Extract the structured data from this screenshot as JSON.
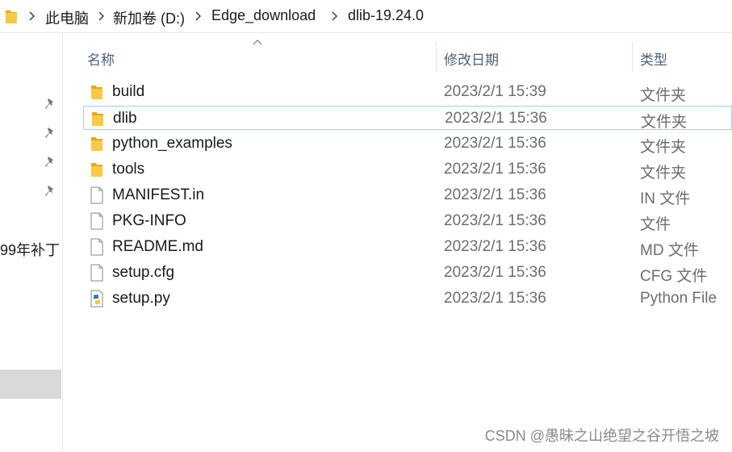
{
  "breadcrumb": [
    "此电脑",
    "新加卷 (D:)",
    "Edge_download",
    "dlib-19.24.0"
  ],
  "nav": {
    "partial_item": "99年补丁"
  },
  "columns": {
    "name": "名称",
    "modified": "修改日期",
    "type": "类型"
  },
  "files": [
    {
      "name": "build",
      "date": "2023/2/1 15:39",
      "type": "文件夹",
      "icon": "folder-icon"
    },
    {
      "name": "dlib",
      "date": "2023/2/1 15:36",
      "type": "文件夹",
      "icon": "folder-icon"
    },
    {
      "name": "python_examples",
      "date": "2023/2/1 15:36",
      "type": "文件夹",
      "icon": "folder-icon"
    },
    {
      "name": "tools",
      "date": "2023/2/1 15:36",
      "type": "文件夹",
      "icon": "folder-icon"
    },
    {
      "name": "MANIFEST.in",
      "date": "2023/2/1 15:36",
      "type": "IN 文件",
      "icon": "file-icon"
    },
    {
      "name": "PKG-INFO",
      "date": "2023/2/1 15:36",
      "type": "文件",
      "icon": "file-icon"
    },
    {
      "name": "README.md",
      "date": "2023/2/1 15:36",
      "type": "MD 文件",
      "icon": "file-icon"
    },
    {
      "name": "setup.cfg",
      "date": "2023/2/1 15:36",
      "type": "CFG 文件",
      "icon": "file-icon"
    },
    {
      "name": "setup.py",
      "date": "2023/2/1 15:36",
      "type": "Python File",
      "icon": "python-file-icon"
    }
  ],
  "watermark": "CSDN @愚昧之山绝望之谷开悟之坡",
  "colors": {
    "folder": "#f8c948",
    "folder_dark": "#e8a814",
    "selection_border": "#99d1ff",
    "header_text": "#4d6179"
  }
}
